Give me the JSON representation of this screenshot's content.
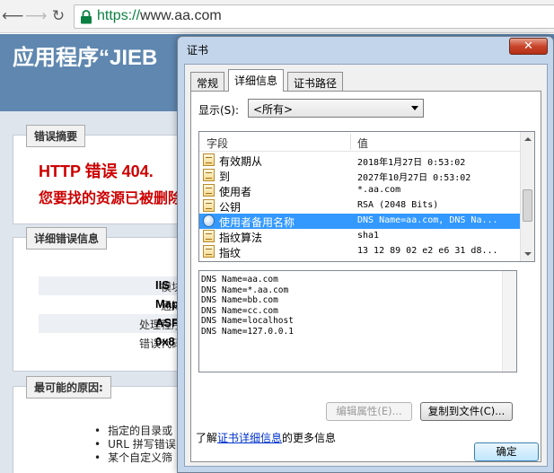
{
  "browser": {
    "url_scheme": "https://",
    "url_rest": "www.aa.com"
  },
  "page": {
    "title": "应用程序“JIEB",
    "error_summary_legend": "错误摘要",
    "error_heading": "HTTP 错误 404.",
    "error_subtext": "您要找的资源已被删除",
    "details_legend": "详细错误信息",
    "details": [
      {
        "key": "模块",
        "value": "IIS"
      },
      {
        "key": "通知",
        "value": "Map"
      },
      {
        "key": "处理程序",
        "value": "ASP"
      },
      {
        "key": "错误代码",
        "value": "0x8"
      }
    ],
    "causes_legend": "最可能的原因:",
    "causes": [
      "指定的目录或",
      "URL 拼写错误",
      "某个自定义筛"
    ]
  },
  "dialog": {
    "title": "证书",
    "close_label": "✕",
    "tabs": [
      "常规",
      "详细信息",
      "证书路径"
    ],
    "active_tab": 1,
    "show_label": "显示(S):",
    "show_value": "<所有>",
    "column_field": "字段",
    "column_value": "值",
    "fields": [
      {
        "name": "有效期从",
        "value": "2018年1月27日 0:53:02",
        "icon": "cert-field-icon"
      },
      {
        "name": "到",
        "value": "2027年10月27日 0:53:02",
        "icon": "cert-field-icon"
      },
      {
        "name": "使用者",
        "value": "*.aa.com",
        "icon": "cert-field-icon"
      },
      {
        "name": "公钥",
        "value": "RSA (2048 Bits)",
        "icon": "cert-field-icon"
      },
      {
        "name": "使用者备用名称",
        "value": "DNS Name=aa.com, DNS Na...",
        "icon": "extension-icon",
        "selected": true
      },
      {
        "name": "指纹算法",
        "value": "sha1",
        "icon": "cert-field-icon"
      },
      {
        "name": "指纹",
        "value": "13 12 89 02 e2 e6 31 d8...",
        "icon": "cert-field-icon"
      }
    ],
    "detail_lines": [
      "DNS Name=aa.com",
      "DNS Name=*.aa.com",
      "DNS Name=bb.com",
      "DNS Name=cc.com",
      "DNS Name=localhost",
      "DNS Name=127.0.0.1"
    ],
    "edit_props_label": "编辑属性(E)...",
    "copy_to_file_label": "复制到文件(C)...",
    "learn_prefix": "了解",
    "learn_link": "证书详细信息",
    "learn_suffix": "的更多信息",
    "ok_label": "确定"
  }
}
